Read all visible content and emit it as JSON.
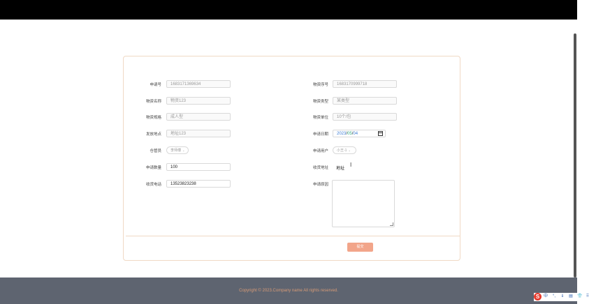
{
  "form": {
    "left": {
      "apply_no_label": "申请号",
      "apply_no_value": "1683171369634",
      "material_name_label": "物资名称",
      "material_name_value": "物资123",
      "material_spec_label": "物资规格",
      "material_spec_value": "成人型",
      "issue_place_label": "发放地点",
      "issue_place_value": "地址123",
      "keeper_label": "仓管员",
      "keeper_value": "李师傅",
      "apply_qty_label": "申请数量",
      "apply_qty_value": "100",
      "receiver_phone_label": "收货电话",
      "receiver_phone_value": "13523823238"
    },
    "right": {
      "material_no_label": "物资序号",
      "material_no_value": "1683170999718",
      "material_type_label": "物资类型",
      "material_type_value": "某类型",
      "material_unit_label": "物资单位",
      "material_unit_value": "10个/包",
      "apply_date_label": "申请日期",
      "apply_date_year": "2023",
      "apply_date_sep1": "/",
      "apply_date_month": "05",
      "apply_date_sep2": "/",
      "apply_date_day": "04",
      "apply_user_label": "申请用户",
      "apply_user_value": "小王-1",
      "receive_addr_label": "收货地址",
      "receive_addr_value": "地址",
      "apply_reason_label": "申请原因",
      "apply_reason_value": ""
    },
    "submit_label": "提交"
  },
  "footer": {
    "copyright": "Copyright © 2023.Company name All rights reserved."
  },
  "tray": {
    "logo": "S",
    "items": [
      "中",
      "°,",
      "⇓",
      "▤",
      "👕",
      "⠿"
    ]
  }
}
